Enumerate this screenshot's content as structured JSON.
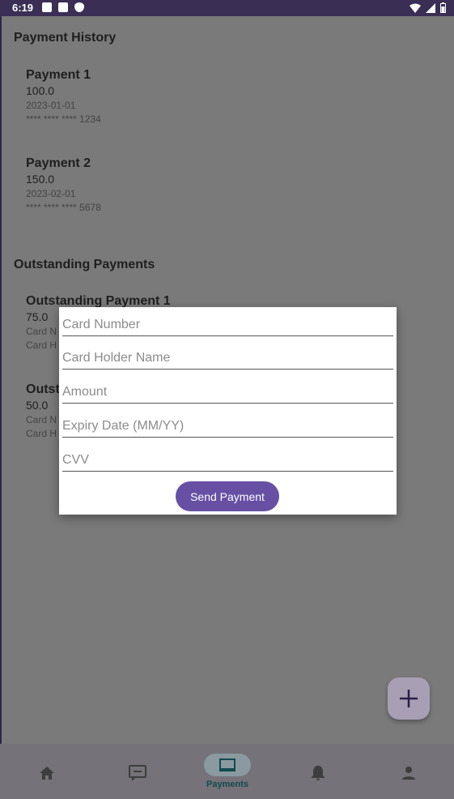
{
  "status_bar": {
    "time": "6:19"
  },
  "payment_history": {
    "title": "Payment History",
    "items": [
      {
        "title": "Payment 1",
        "amount": "100.0",
        "date": "2023-01-01",
        "card": "**** **** **** 1234"
      },
      {
        "title": "Payment 2",
        "amount": "150.0",
        "date": "2023-02-01",
        "card": "**** **** **** 5678"
      }
    ]
  },
  "outstanding": {
    "title": "Outstanding Payments",
    "items": [
      {
        "title": "Outstanding Payment 1",
        "amount": "75.0",
        "line1": "Card N",
        "line2": "Card H"
      },
      {
        "title": "Outst",
        "amount": "50.0",
        "line1": "Card N",
        "line2": "Card H"
      }
    ]
  },
  "dialog": {
    "fields": {
      "card_number": "Card Number",
      "card_holder": "Card Holder Name",
      "amount": "Amount",
      "expiry": "Expiry Date (MM/YY)",
      "cvv": "CVV"
    },
    "send_label": "Send Payment"
  },
  "bottom_nav": {
    "active_label": "Payments",
    "items": [
      "home-icon",
      "chat-icon",
      "payments-icon",
      "notifications-icon",
      "profile-icon"
    ]
  },
  "colors": {
    "accent": "#6750a4",
    "status_bar": "#3a2e55"
  }
}
